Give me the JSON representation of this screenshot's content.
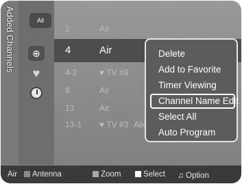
{
  "title": "Added Channels",
  "icons": {
    "all_label": "All"
  },
  "channels": [
    {
      "num": "2",
      "name": "Air"
    },
    {
      "num": "4",
      "name": "Air"
    },
    {
      "num": "4-2",
      "name": "♥ TV #8"
    },
    {
      "num": "8",
      "name": "Air"
    },
    {
      "num": "13",
      "name": "Air"
    },
    {
      "num": "13-1",
      "name": "♥ TV #3",
      "extra": "Alice"
    }
  ],
  "menu": [
    "Delete",
    "Add to Favorite",
    "Timer Viewing",
    "Channel Name Edit",
    "Select All",
    "Auto Program"
  ],
  "bottom": {
    "source": "Air",
    "antenna": "Antenna",
    "zoom": "Zoom",
    "select": "Select",
    "option": "Option"
  }
}
